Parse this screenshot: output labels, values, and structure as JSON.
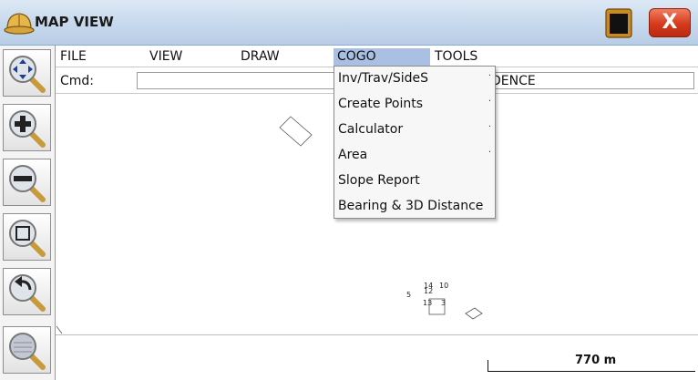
{
  "window": {
    "title": "MAP VIEW",
    "close_glyph": "X"
  },
  "toolbar": {
    "items": [
      {
        "name": "pan-zoom-icon"
      },
      {
        "name": "zoom-in-icon"
      },
      {
        "name": "zoom-out-icon"
      },
      {
        "name": "zoom-window-icon"
      },
      {
        "name": "zoom-previous-icon"
      },
      {
        "name": "zoom-extents-icon"
      }
    ]
  },
  "menubar": {
    "items": [
      {
        "label": "FILE"
      },
      {
        "label": "VIEW"
      },
      {
        "label": "DRAW"
      },
      {
        "label": "COGO",
        "active": true
      },
      {
        "label": "TOOLS"
      }
    ]
  },
  "command": {
    "label": "Cmd:",
    "value": "",
    "trailing_text": "DENCE"
  },
  "dropdown": {
    "items": [
      {
        "label": "Inv/Trav/SideS",
        "submenu": true
      },
      {
        "label": "Create Points",
        "submenu": true
      },
      {
        "label": "Calculator",
        "submenu": true
      },
      {
        "label": "Area",
        "submenu": true
      },
      {
        "label": "Slope Report",
        "submenu": false
      },
      {
        "label": "Bearing & 3D Distance",
        "submenu": false
      }
    ],
    "submenu_glyph": "·"
  },
  "map": {
    "point_labels": [
      "5",
      "14",
      "10",
      "12",
      "13",
      "3"
    ],
    "scale_label": "770 m"
  },
  "colors": {
    "titlebar": "#c6d8ec",
    "menu_highlight": "#a9c0e3",
    "close_button": "#d63a1c"
  }
}
